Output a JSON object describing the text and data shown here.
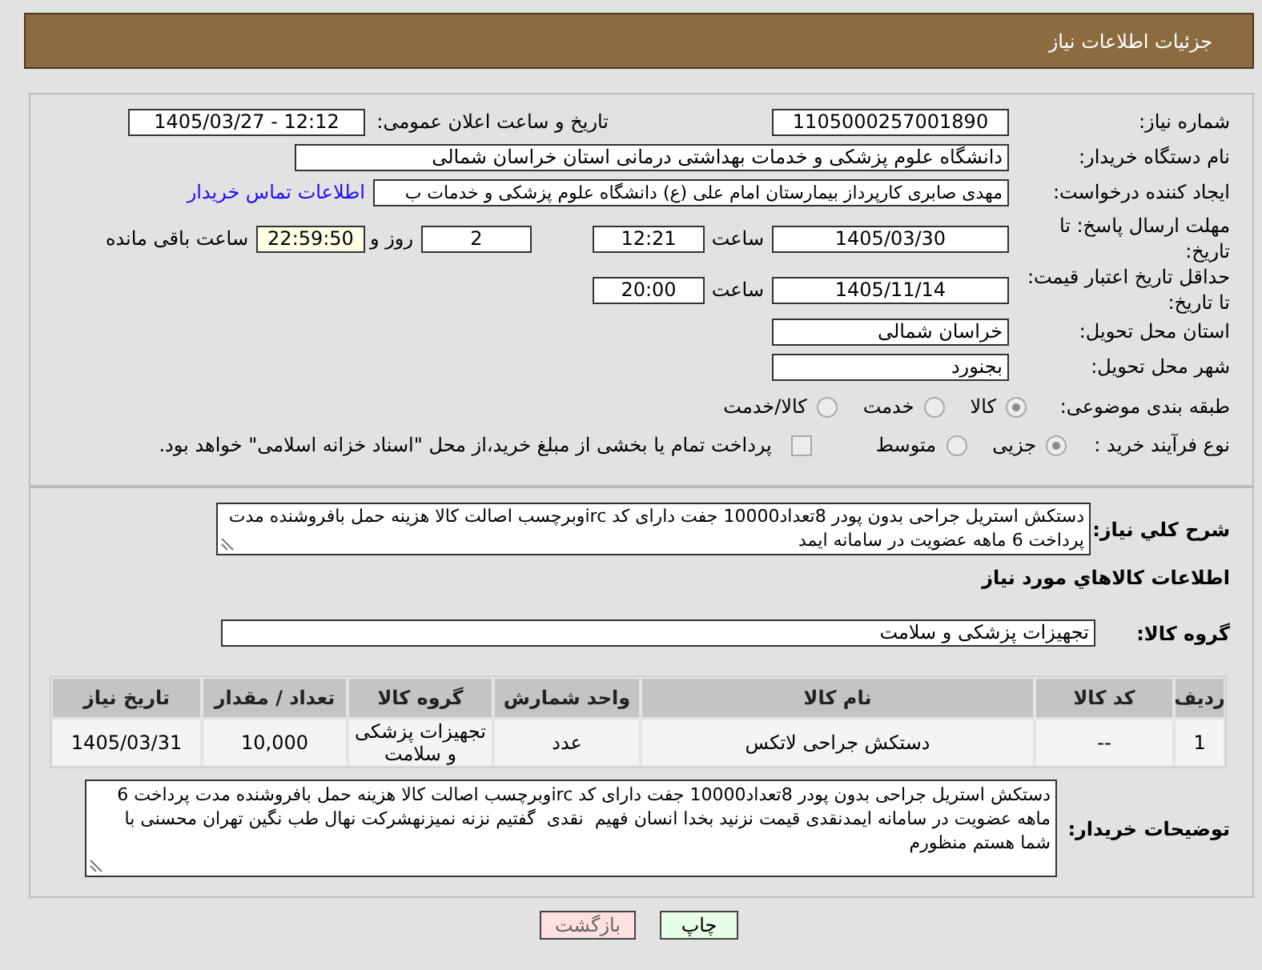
{
  "header": {
    "title": "جزئیات اطلاعات نیاز"
  },
  "general": {
    "need_number": {
      "label": "شماره نیاز:",
      "value": "1105000257001890"
    },
    "announce": {
      "label": "تاریخ و ساعت اعلان عمومی:",
      "value": "1405/03/27 - 12:12"
    },
    "buyer_org": {
      "label": "نام دستگاه خریدار:",
      "value": "دانشگاه علوم پزشکی و خدمات بهداشتی درمانی استان خراسان شمالی"
    },
    "creator": {
      "label": "ایجاد کننده درخواست:",
      "value": "مهدی صابری کارپرداز بیمارستان امام علی (ع) دانشگاه علوم پزشکی و خدمات ب",
      "contact_link": "اطلاعات تماس خریدار"
    },
    "deadline": {
      "label": "مهلت ارسال پاسخ: تا تاریخ:",
      "date": "1405/03/30",
      "time_label": "ساعت",
      "time": "12:21",
      "days": "2",
      "days_label": "روز و",
      "remaining": "22:59:50",
      "remaining_label": "ساعت باقی مانده"
    },
    "validity": {
      "label": "حداقل تاریخ اعتبار قیمت: تا تاریخ:",
      "date": "1405/11/14",
      "time_label": "ساعت",
      "time": "20:00"
    },
    "province": {
      "label": "استان محل تحویل:",
      "value": "خراسان شمالی"
    },
    "city": {
      "label": "شهر محل تحویل:",
      "value": "بجنورد"
    },
    "category": {
      "label": "طبقه بندی موضوعی:",
      "options": [
        {
          "label": "کالا",
          "selected": true,
          "disabled": true
        },
        {
          "label": "خدمت",
          "selected": false,
          "disabled": true
        },
        {
          "label": "کالا/خدمت",
          "selected": false,
          "disabled": true
        }
      ]
    },
    "process": {
      "label": "نوع فرآیند خرید :",
      "options": [
        {
          "label": "جزیی",
          "selected": true,
          "disabled": true
        },
        {
          "label": "متوسط",
          "selected": false,
          "disabled": true
        }
      ],
      "treasury_checkbox": {
        "label": "پرداخت تمام یا بخشی از مبلغ خرید،از محل \"اسناد خزانه اسلامی\" خواهد بود.",
        "checked": false,
        "disabled": true
      }
    }
  },
  "details": {
    "summary": {
      "label": "شرح کلي نياز:",
      "value": "دستکش استریل جراحی بدون پودر 8تعداد10000 جفت دارای کد ircوبرچسب اصالت کالا هزینه حمل بافروشنده مدت پرداخت 6 ماهه عضویت در سامانه ایمد"
    },
    "items_title": "اطلاعات کالاهاي مورد نياز",
    "group": {
      "label": "گروه کالا:",
      "value": "تجهیزات پزشکی و سلامت"
    },
    "table": {
      "columns": [
        "ردیف",
        "کد کالا",
        "نام کالا",
        "واحد شمارش",
        "گروه کالا",
        "تعداد / مقدار",
        "تاریخ نیاز"
      ],
      "rows": [
        [
          "1",
          "--",
          "دستکش جراحی لاتکس",
          "عدد",
          "تجهیزات پزشکی و سلامت",
          "10,000",
          "1405/03/31"
        ]
      ]
    },
    "buyer_notes": {
      "label": "توضیحات خریدار:",
      "value": "دستکش استریل جراحی بدون پودر 8تعداد10000 جفت دارای کد ircوبرچسب اصالت کالا هزینه حمل بافروشنده مدت پرداخت 6 ماهه عضویت در سامانه ایمدنقدی قیمت نزنید بخدا انسان فهیم  نقدی  گفتیم نزنه نمیزنهشرکت نهال طب نگین تهران محسنی با شما هستم منظورم"
    }
  },
  "buttons": [
    {
      "label": "چاپ",
      "kind": "print"
    },
    {
      "label": "بازگشت",
      "kind": "back"
    }
  ]
}
